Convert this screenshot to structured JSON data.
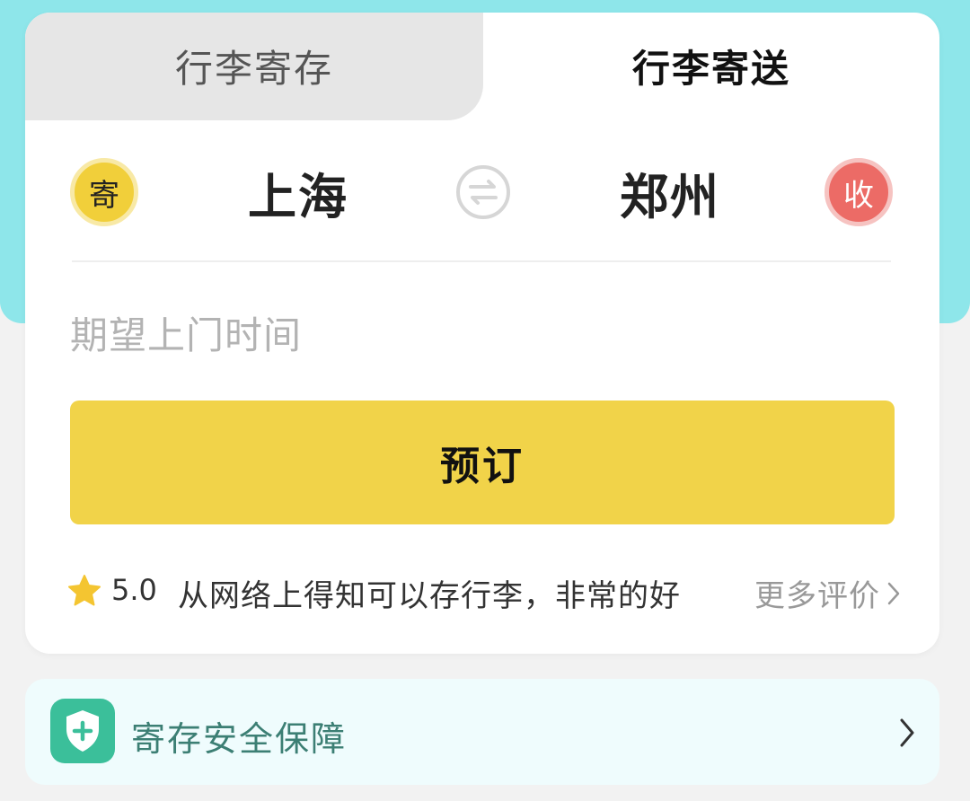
{
  "tabs": [
    {
      "label": "行李寄存",
      "active": false
    },
    {
      "label": "行李寄送",
      "active": true
    }
  ],
  "route": {
    "send_badge": "寄",
    "from_city": "上海",
    "to_city": "郑州",
    "receive_badge": "收"
  },
  "time_field": {
    "placeholder": "期望上门时间"
  },
  "book_button": {
    "label": "预订"
  },
  "review": {
    "rating": "5.0",
    "text": "从网络上得知可以存行李，非常的好",
    "more_label": "更多评价"
  },
  "safety": {
    "label": "寄存安全保障"
  },
  "colors": {
    "header_bg": "#8ee6ea",
    "accent_yellow": "#f1d349",
    "receive_red": "#ec6b66",
    "safety_green": "#3bbf9a"
  },
  "icons": {
    "swap": "swap-arrows-icon",
    "star": "star-icon",
    "shield": "shield-plus-icon",
    "chevron": "chevron-right-icon"
  }
}
